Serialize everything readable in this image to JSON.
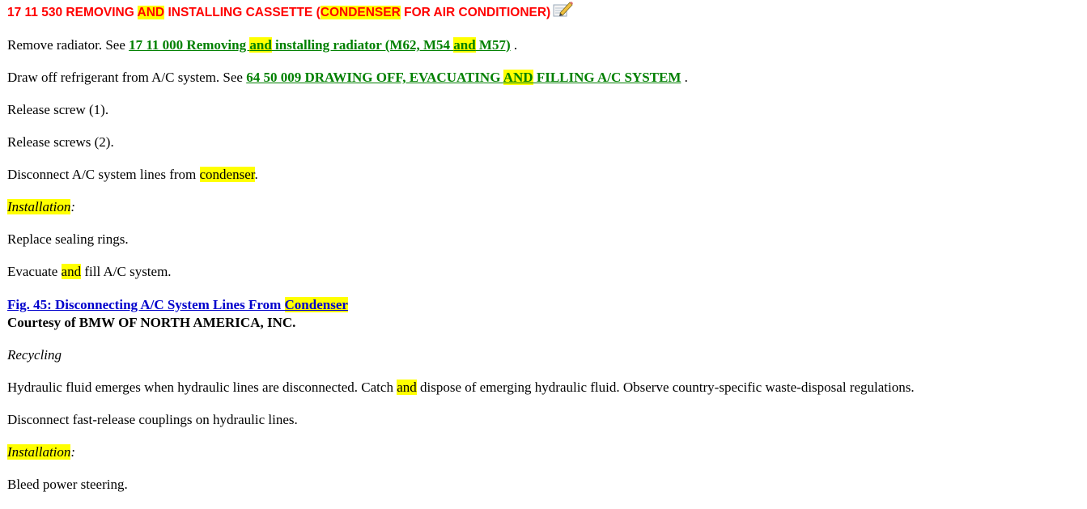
{
  "title": {
    "part1": "17 11 530 REMOVING ",
    "hl1": "AND",
    "part2": " INSTALLING CASSETTE (",
    "hl2": "CONDENSER",
    "part3": " FOR AIR CONDITIONER)"
  },
  "icons": {
    "edit": "edit-note-icon"
  },
  "steps": {
    "s1": {
      "pre": "Remove radiator. See ",
      "link_a": "17 11 000 Removing ",
      "link_hl1": "and",
      "link_b": " installing radiator (M62, M54 ",
      "link_hl2": "and",
      "link_c": " M57)",
      "post": " ."
    },
    "s2": {
      "pre": "Draw off refrigerant from A/C system. See ",
      "link_a": "64 50 009 DRAWING OFF, EVACUATING ",
      "link_hl": "AND",
      "link_b": " FILLING A/C SYSTEM",
      "post": " ."
    },
    "s3": "Release screw (1).",
    "s4": "Release screws (2).",
    "s5": {
      "pre": "Disconnect A/C system lines from ",
      "hl": "condenser",
      "post": "."
    },
    "install1": {
      "label": "Installation",
      "colon": ":"
    },
    "s6": "Replace sealing rings.",
    "s7": {
      "pre": "Evacuate ",
      "hl": "and",
      "post": " fill A/C system."
    }
  },
  "figure": {
    "link_text": "Fig. 45: Disconnecting A/C System Lines From ",
    "link_hl": "Condenser",
    "courtesy": "Courtesy of BMW OF NORTH AMERICA, INC."
  },
  "recycling": {
    "heading": "Recycling",
    "p1": {
      "pre": "Hydraulic fluid emerges when hydraulic lines are disconnected. Catch ",
      "hl": "and",
      "post": " dispose of emerging hydraulic fluid. Observe country-specific waste-disposal regulations."
    },
    "p2": "Disconnect fast-release couplings on hydraulic lines.",
    "install2": {
      "label": "Installation",
      "colon": ":"
    },
    "p3": "Bleed power steering."
  }
}
